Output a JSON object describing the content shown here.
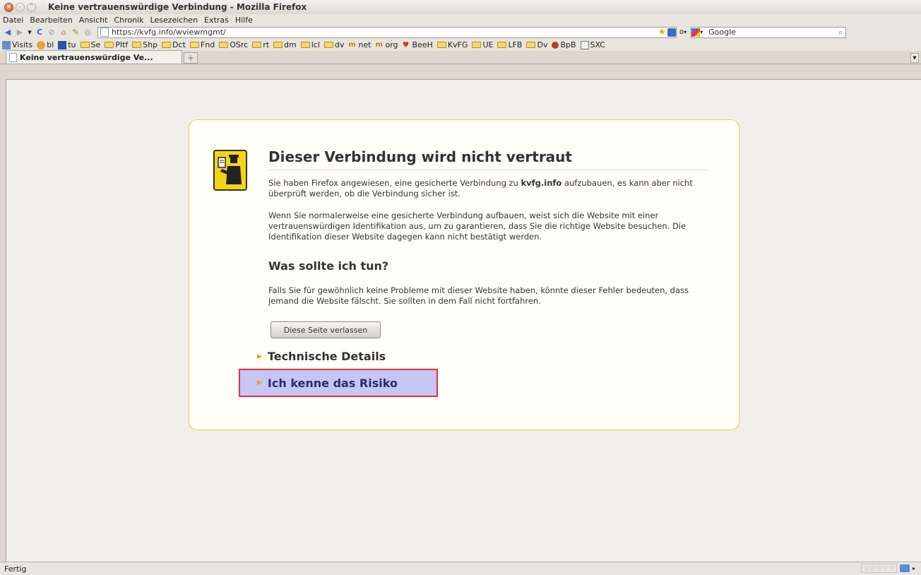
{
  "window": {
    "title": "Keine vertrauenswürdige Verbindung - Mozilla Firefox"
  },
  "menu": [
    "Datei",
    "Bearbeiten",
    "Ansicht",
    "Chronik",
    "Lesezeichen",
    "Extras",
    "Hilfe"
  ],
  "nav": {
    "url": "https://kvfg.info/wviewmgmt/",
    "search_engine": "Google",
    "search_value": "Google",
    "feed_indicator": "o"
  },
  "bookmarks": [
    {
      "label": "Visits",
      "icon": "page-icon"
    },
    {
      "label": "bl",
      "icon": "face-icon"
    },
    {
      "label": "tu",
      "icon": "calendar-icon"
    },
    {
      "label": "Se",
      "icon": "folder-icon"
    },
    {
      "label": "Pltf",
      "icon": "folder-icon"
    },
    {
      "label": "Shp",
      "icon": "folder-icon"
    },
    {
      "label": "Dct",
      "icon": "folder-icon"
    },
    {
      "label": "Fnd",
      "icon": "folder-icon"
    },
    {
      "label": "OSrc",
      "icon": "folder-icon"
    },
    {
      "label": "rt",
      "icon": "folder-icon"
    },
    {
      "label": "dm",
      "icon": "folder-icon"
    },
    {
      "label": "lcl",
      "icon": "folder-icon"
    },
    {
      "label": "dv",
      "icon": "folder-icon"
    },
    {
      "label": "net",
      "icon": "m-icon"
    },
    {
      "label": "org",
      "icon": "m-icon"
    },
    {
      "label": "BeeH",
      "icon": "bee-icon"
    },
    {
      "label": "KvFG",
      "icon": "folder-icon"
    },
    {
      "label": "UE",
      "icon": "folder-icon"
    },
    {
      "label": "LFB",
      "icon": "folder-icon"
    },
    {
      "label": "Dv",
      "icon": "folder-icon"
    },
    {
      "label": "BpB",
      "icon": "red-dot-icon"
    },
    {
      "label": "SXC",
      "icon": "box-icon"
    }
  ],
  "tab": {
    "label": "Keine vertrauenswürdige Ve..."
  },
  "error": {
    "title": "Dieser Verbindung wird nicht vertraut",
    "p1_before": "Sie haben Firefox angewiesen, eine gesicherte Verbindung zu ",
    "p1_host": "kvfg.info",
    "p1_after": " aufzubauen, es kann aber nicht überprüft werden, ob die Verbindung sicher ist.",
    "p2": "Wenn Sie normalerweise eine gesicherte Verbindung aufbauen, weist sich die Website mit einer vertrauenswürdigen Identifikation aus, um zu garantieren, dass Sie die richtige Website besuchen. Die Identifikation dieser Website dagegen kann nicht bestätigt werden.",
    "subhead": "Was sollte ich tun?",
    "p3": "Falls Sie für gewöhnlich keine Probleme mit dieser Website haben, könnte dieser Fehler bedeuten, dass jemand die Website fälscht. Sie sollten in dem Fall nicht fortfahren.",
    "leave_button": "Diese Seite verlassen",
    "technical_details": "Technische Details",
    "understand_risks": "Ich kenne das Risiko"
  },
  "status": {
    "text": "Fertig"
  },
  "colors": {
    "error_border": "#f0c860",
    "highlight_fill": "#c6c5f4",
    "highlight_border": "#e8303a",
    "icon_yellow": "#f5d418"
  }
}
